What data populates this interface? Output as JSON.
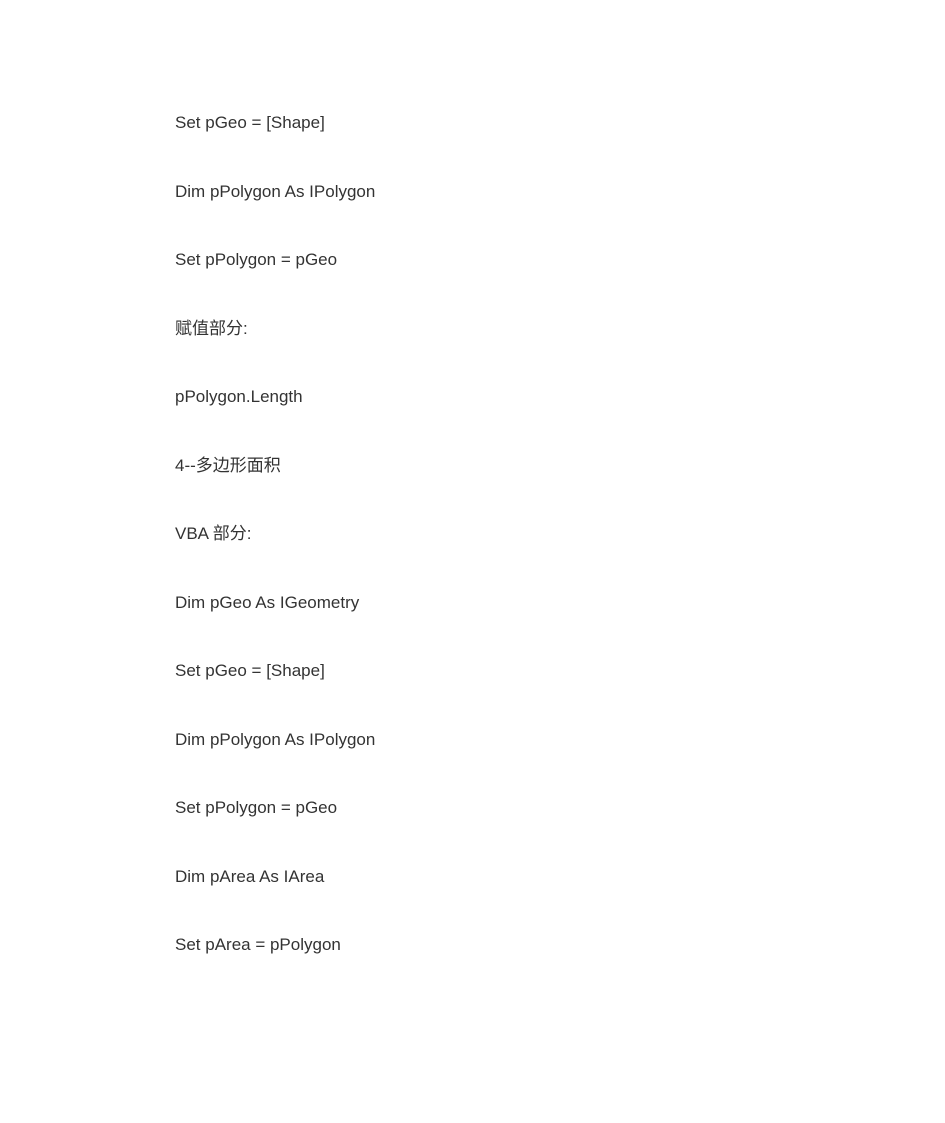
{
  "lines": [
    "Set pGeo = [Shape]",
    "Dim pPolygon As IPolygon",
    "Set pPolygon = pGeo",
    "赋值部分:",
    "pPolygon.Length",
    "4--多边形面积",
    "VBA 部分:",
    "Dim pGeo As IGeometry",
    "Set pGeo = [Shape]",
    "Dim pPolygon As IPolygon",
    "Set pPolygon = pGeo",
    "Dim pArea As IArea",
    "Set pArea = pPolygon"
  ]
}
